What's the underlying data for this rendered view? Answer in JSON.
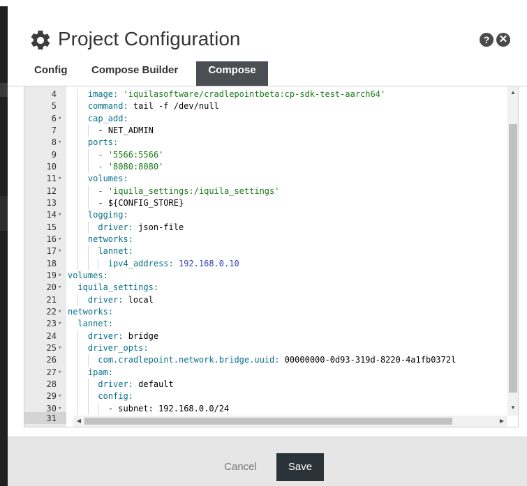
{
  "dialog": {
    "title": "Project Configuration",
    "help_label": "?",
    "close_label": "✕",
    "icons": {
      "title": "gear-icon",
      "help": "help-icon",
      "close": "close-icon"
    }
  },
  "tabs": [
    {
      "label": "Config",
      "active": false
    },
    {
      "label": "Compose Builder",
      "active": false
    },
    {
      "label": "Compose",
      "active": true
    }
  ],
  "editor": {
    "lines": [
      {
        "n": "4",
        "fold": false,
        "indent": 4,
        "key": "image:",
        "val": " 'iquilasoftware/cradlepointbeta:cp-sdk-test-aarch64'",
        "vt": "s"
      },
      {
        "n": "5",
        "fold": false,
        "indent": 4,
        "key": "command:",
        "val": " tail -f /dev/null",
        "vt": "p"
      },
      {
        "n": "6",
        "fold": true,
        "indent": 4,
        "key": "cap_add:",
        "val": "",
        "vt": "p"
      },
      {
        "n": "7",
        "fold": false,
        "indent": 6,
        "key": "",
        "val": "- NET_ADMIN",
        "vt": "p"
      },
      {
        "n": "8",
        "fold": true,
        "indent": 4,
        "key": "ports:",
        "val": "",
        "vt": "p"
      },
      {
        "n": "9",
        "fold": false,
        "indent": 6,
        "key": "",
        "val": "- '5566:5566'",
        "vt": "s"
      },
      {
        "n": "10",
        "fold": false,
        "indent": 6,
        "key": "",
        "val": "- '8080:8080'",
        "vt": "s"
      },
      {
        "n": "11",
        "fold": true,
        "indent": 4,
        "key": "volumes:",
        "val": "",
        "vt": "p"
      },
      {
        "n": "12",
        "fold": false,
        "indent": 6,
        "key": "",
        "val": "- 'iquila_settings:/iquila_settings'",
        "vt": "s"
      },
      {
        "n": "13",
        "fold": false,
        "indent": 6,
        "key": "",
        "val": "- ${CONFIG_STORE}",
        "vt": "p"
      },
      {
        "n": "14",
        "fold": true,
        "indent": 4,
        "key": "logging:",
        "val": "",
        "vt": "p"
      },
      {
        "n": "15",
        "fold": false,
        "indent": 6,
        "key": "driver:",
        "val": " json-file",
        "vt": "p"
      },
      {
        "n": "16",
        "fold": true,
        "indent": 4,
        "key": "networks:",
        "val": "",
        "vt": "p"
      },
      {
        "n": "17",
        "fold": true,
        "indent": 6,
        "key": "lannet:",
        "val": "",
        "vt": "p"
      },
      {
        "n": "18",
        "fold": false,
        "indent": 8,
        "key": "ipv4_address:",
        "val": " 192.168.0.10",
        "vt": "n"
      },
      {
        "n": "19",
        "fold": true,
        "indent": 0,
        "key": "volumes:",
        "val": "",
        "vt": "p"
      },
      {
        "n": "20",
        "fold": true,
        "indent": 2,
        "key": "iquila_settings:",
        "val": "",
        "vt": "p"
      },
      {
        "n": "21",
        "fold": false,
        "indent": 4,
        "key": "driver:",
        "val": " local",
        "vt": "p"
      },
      {
        "n": "22",
        "fold": true,
        "indent": 0,
        "key": "networks:",
        "val": "",
        "vt": "p"
      },
      {
        "n": "23",
        "fold": true,
        "indent": 2,
        "key": "lannet:",
        "val": "",
        "vt": "p"
      },
      {
        "n": "24",
        "fold": false,
        "indent": 4,
        "key": "driver:",
        "val": " bridge",
        "vt": "p"
      },
      {
        "n": "25",
        "fold": true,
        "indent": 4,
        "key": "driver_opts:",
        "val": "",
        "vt": "p"
      },
      {
        "n": "26",
        "fold": false,
        "indent": 6,
        "key": "com.cradlepoint.network.bridge.uuid:",
        "val": " 00000000-0d93-319d-8220-4a1fb0372l",
        "vt": "p"
      },
      {
        "n": "27",
        "fold": true,
        "indent": 4,
        "key": "ipam:",
        "val": "",
        "vt": "p"
      },
      {
        "n": "28",
        "fold": false,
        "indent": 6,
        "key": "driver:",
        "val": " default",
        "vt": "p"
      },
      {
        "n": "29",
        "fold": true,
        "indent": 6,
        "key": "config:",
        "val": "",
        "vt": "p"
      },
      {
        "n": "30",
        "fold": true,
        "indent": 8,
        "key": "",
        "val": "- subnet: 192.168.0.0/24",
        "vt": "p"
      }
    ],
    "current_line_number": "31",
    "fold_glyph": "▾",
    "arrows": {
      "up": "▲",
      "down": "▼",
      "left": "◀",
      "right": "▶"
    }
  },
  "footer": {
    "cancel_label": "Cancel",
    "save_label": "Save"
  },
  "colors": {
    "active_tab": "#4b4f53",
    "save_button": "#2c3338",
    "yaml_key": "#06708a",
    "yaml_string": "#1a7a1a",
    "yaml_number": "#2e3fb0"
  }
}
